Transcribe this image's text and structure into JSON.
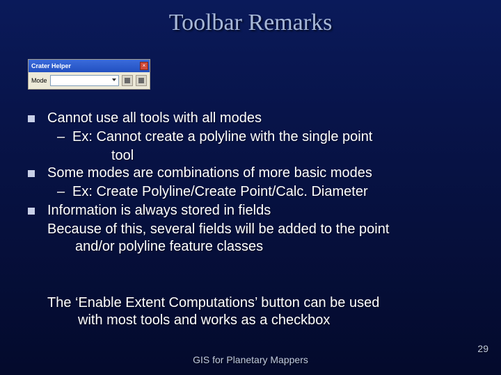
{
  "title": "Toolbar Remarks",
  "toolbar": {
    "window_title": "Crater Helper",
    "mode_label": "Mode"
  },
  "bullets": [
    {
      "text": "Cannot use all tools with all modes",
      "subs": [
        {
          "lead": "Ex: Cannot create a polyline with the single point",
          "cont": "tool"
        }
      ]
    },
    {
      "text": "Some modes are combinations of more basic modes",
      "subs": [
        {
          "lead": "Ex: Create Polyline/Create Point/Calc. Diameter"
        }
      ]
    },
    {
      "text": "Information is always stored in fields",
      "body": {
        "lead": "Because of this, several fields will be added to the point",
        "cont": "and/or polyline feature classes"
      }
    }
  ],
  "note": {
    "lead": "The ‘Enable Extent Computations’ button can be used",
    "cont": "with most tools and works as a checkbox"
  },
  "footer": "GIS for Planetary Mappers",
  "page_number": "29",
  "dash": "–"
}
